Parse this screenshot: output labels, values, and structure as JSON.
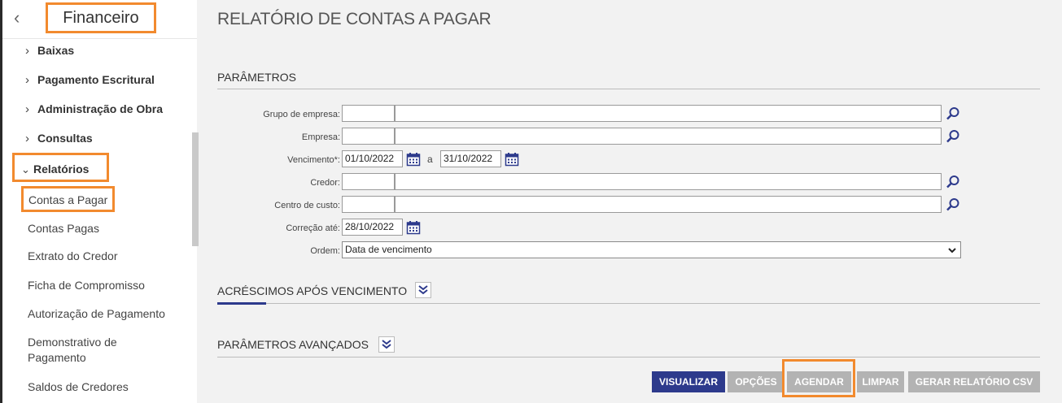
{
  "sidebar": {
    "back_icon": "chevron-left-icon",
    "title": "Financeiro",
    "menu": [
      {
        "label": "Baixas",
        "expanded": false
      },
      {
        "label": "Pagamento Escritural",
        "expanded": false
      },
      {
        "label": "Administração de Obra",
        "expanded": false
      },
      {
        "label": "Consultas",
        "expanded": false
      },
      {
        "label": "Relatórios",
        "expanded": true
      }
    ],
    "submenu": [
      "Contas a Pagar",
      "Contas Pagas",
      "Extrato do Credor",
      "Ficha de Compromisso",
      "Autorização de Pagamento",
      "Demonstrativo de Pagamento",
      "Saldos de Credores"
    ],
    "active_submenu": "Contas a Pagar"
  },
  "main": {
    "page_title": "RELATÓRIO DE CONTAS A PAGAR",
    "sections": {
      "parametros": "PARÂMETROS",
      "acrescimos": "ACRÉSCIMOS APÓS VENCIMENTO",
      "avancados": "PARÂMETROS AVANÇADOS"
    },
    "form": {
      "grupo_empresa_label": "Grupo de empresa:",
      "empresa_label": "Empresa:",
      "vencimento_label": "Vencimento*:",
      "vencimento_start": "01/10/2022",
      "vencimento_sep": "a",
      "vencimento_end": "31/10/2022",
      "credor_label": "Credor:",
      "centro_custo_label": "Centro de custo:",
      "correcao_label": "Correção até:",
      "correcao_value": "28/10/2022",
      "ordem_label": "Ordem:",
      "ordem_value": "Data de vencimento"
    },
    "buttons": {
      "visualizar": "VISUALIZAR",
      "opcoes": "OPÇÕES",
      "agendar": "AGENDAR",
      "limpar": "LIMPAR",
      "gerar_csv": "GERAR RELATÓRIO CSV"
    }
  },
  "colors": {
    "accent": "#2d3a8c",
    "highlight": "#f28a2e",
    "button_disabled": "#b3b3b3"
  }
}
